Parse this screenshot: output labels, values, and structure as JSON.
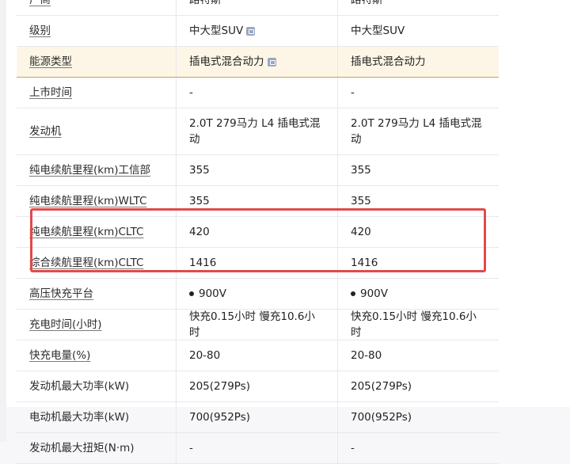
{
  "rows": [
    {
      "label": "厂商",
      "v1": "路特斯",
      "v2": "路特斯",
      "link": true,
      "h": 38
    },
    {
      "label": "级别",
      "v1": "中大型SUV",
      "v2": "中大型SUV",
      "link": true,
      "icon": true,
      "h": 38
    },
    {
      "label": "能源类型",
      "v1": "插电式混合动力",
      "v2": "插电式混合动力",
      "link": true,
      "icon": true,
      "highlight": true,
      "h": 38
    },
    {
      "label": "上市时间",
      "v1": "-",
      "v2": "-",
      "link": true,
      "h": 38
    },
    {
      "label": "发动机",
      "v1": "2.0T 279马力 L4 插电式混动",
      "v2": "2.0T 279马力 L4 插电式混动",
      "link": true,
      "h": 58
    },
    {
      "label": "纯电续航里程(km)工信部",
      "v1": "355",
      "v2": "355",
      "link": true,
      "h": 38
    },
    {
      "label": "纯电续航里程(km)WLTC",
      "v1": "355",
      "v2": "355",
      "link": true,
      "h": 38
    },
    {
      "label": "纯电续航里程(km)CLTC",
      "v1": "420",
      "v2": "420",
      "link": true,
      "h": 38
    },
    {
      "label": "综合续航里程(km)CLTC",
      "v1": "1416",
      "v2": "1416",
      "link": true,
      "h": 38
    },
    {
      "label": "高压快充平台",
      "v1": "900V",
      "v2": "900V",
      "link": true,
      "dot": true,
      "h": 38
    },
    {
      "label": "充电时间(小时)",
      "v1": "快充0.15小时 慢充10.6小时",
      "v2": "快充0.15小时 慢充10.6小时",
      "link": true,
      "h": 38
    },
    {
      "label": "快充电量(%)",
      "v1": "20-80",
      "v2": "20-80",
      "link": true,
      "h": 38
    },
    {
      "label": "发动机最大功率(kW)",
      "v1": "205(279Ps)",
      "v2": "205(279Ps)",
      "link": false,
      "h": 38
    },
    {
      "label": "电动机最大功率(kW)",
      "v1": "700(952Ps)",
      "v2": "700(952Ps)",
      "link": false,
      "h": 38
    },
    {
      "label": "发动机最大扭矩(N·m)",
      "v1": "-",
      "v2": "-",
      "link": false,
      "h": 38
    }
  ],
  "colors": {
    "highlight_bg": "#fdf6e6",
    "annotation_box": "#e14a4a"
  }
}
